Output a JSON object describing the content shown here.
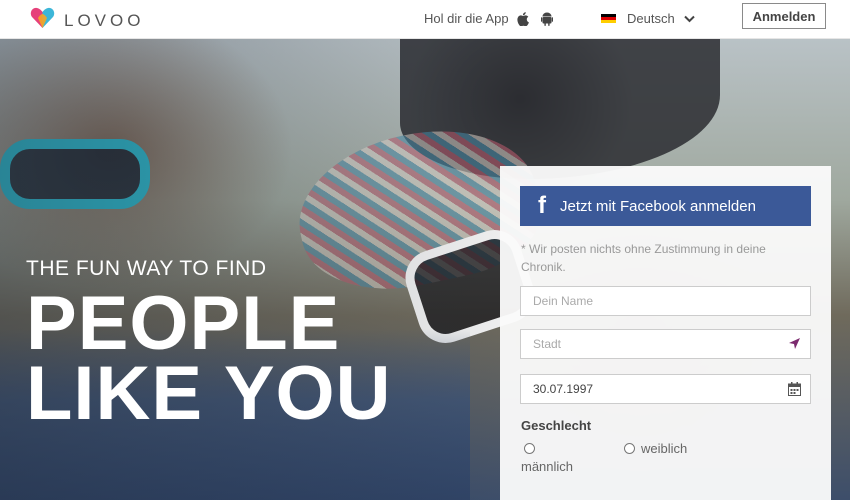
{
  "header": {
    "logo_text": "LOVOO",
    "app_text": "Hol dir die App",
    "app_icons": [
      "apple-icon",
      "android-icon"
    ],
    "language": "Deutsch",
    "language_flag": "german-flag",
    "login_label": "Anmelden"
  },
  "hero": {
    "tagline": "THE FUN WAY TO FIND",
    "headline_line1": "PEOPLE",
    "headline_line2": "LIKE YOU"
  },
  "form": {
    "facebook_label": "Jetzt mit Facebook anmelden",
    "facebook_note": "* Wir posten nichts ohne Zustimmung in deine Chronik.",
    "name_placeholder": "Dein Name",
    "city_placeholder": "Stadt",
    "birthdate_value": "30.07.1997",
    "gender_label": "Geschlecht",
    "gender_options": [
      "männlich",
      "weiblich"
    ]
  },
  "colors": {
    "facebook_blue": "#3b5998",
    "logo_heart": [
      "#e6407a",
      "#3cb6d8",
      "#f5a623"
    ],
    "location_icon": "#7b2a6e"
  }
}
